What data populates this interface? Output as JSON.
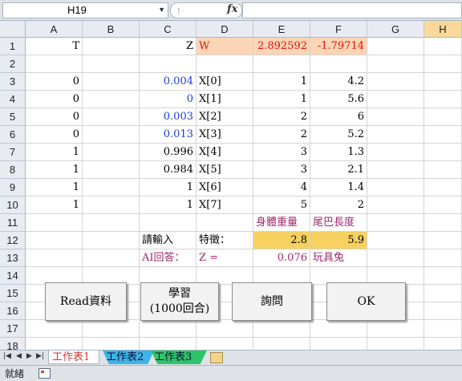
{
  "formula_bar": {
    "name_box": "H19",
    "fx_label": "fx",
    "formula": ""
  },
  "columns": [
    "A",
    "B",
    "C",
    "D",
    "E",
    "F",
    "G",
    "H"
  ],
  "rows": [
    "1",
    "2",
    "3",
    "4",
    "5",
    "6",
    "7",
    "8",
    "9",
    "10",
    "11",
    "12",
    "13",
    "14",
    "15",
    "16",
    "17",
    "18"
  ],
  "cells": {
    "A1": "T",
    "C1": "Z",
    "D1": "W",
    "E1": "2.892592",
    "F1": "-1.79714",
    "A3": "0",
    "C3": "0.004",
    "D3": "X[0]",
    "E3": "1",
    "F3": "4.2",
    "A4": "0",
    "C4": "0",
    "D4": "X[1]",
    "E4": "1",
    "F4": "5.6",
    "A5": "0",
    "C5": "0.003",
    "D5": "X[2]",
    "E5": "2",
    "F5": "6",
    "A6": "0",
    "C6": "0.013",
    "D6": "X[3]",
    "E6": "2",
    "F6": "5.2",
    "A7": "1",
    "C7": "0.996",
    "D7": "X[4]",
    "E7": "3",
    "F7": "1.3",
    "A8": "1",
    "C8": "0.984",
    "D8": "X[5]",
    "E8": "3",
    "F8": "2.1",
    "A9": "1",
    "C9": "1",
    "D9": "X[6]",
    "E9": "4",
    "F9": "1.4",
    "A10": "1",
    "C10": "1",
    "D10": "X[7]",
    "E10": "5",
    "F10": "2",
    "E11": "身體重量",
    "F11": "尾巴長度",
    "C12": "請輸入",
    "D12": "特徵：",
    "E12": "2.8",
    "F12": "5.9",
    "C13": "AI回答：",
    "D13": "Z =",
    "E13": "0.076",
    "F13": "玩具兔"
  },
  "buttons": {
    "read": "Read資料",
    "learn_line1": "學習",
    "learn_line2": "(1000回合)",
    "ask": "詢問",
    "ok": "OK"
  },
  "sheet_tabs": [
    "工作表1",
    "工作表2",
    "工作表3"
  ],
  "status": {
    "text": "就緒"
  },
  "colors": {
    "blue_text": "#1f3fd0",
    "red_text": "#e01010",
    "purple_text": "#9b2a6b",
    "peach_fill": "#fbd5b5",
    "gold_fill": "#f7d160",
    "selected_header": "#f9d99a"
  }
}
